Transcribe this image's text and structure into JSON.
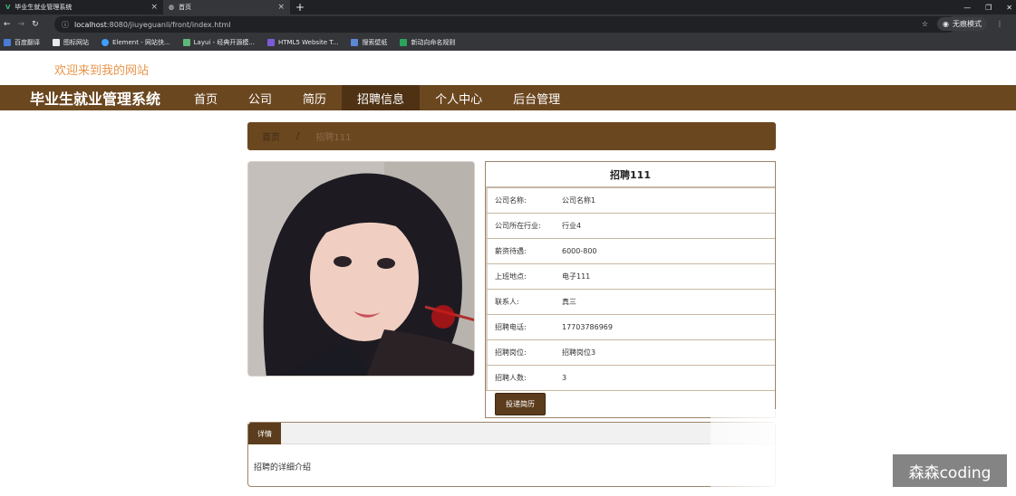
{
  "browser": {
    "tabs": [
      {
        "title": "毕业生就业管理系统",
        "active": false
      },
      {
        "title": "首页",
        "active": true
      }
    ],
    "url_host": "localhost",
    "url_rest": ":8080/jiuyeguanli/front/index.html",
    "profile_label": "无痕模式",
    "bookmarks": [
      "百度翻译",
      "图标网站",
      "Element - 网站快...",
      "Layui - 经典开源模...",
      "HTML5 Website T...",
      "搜索壁纸",
      "新动向命名规则"
    ]
  },
  "site": {
    "welcome": "欢迎来到我的网站",
    "brand": "毕业生就业管理系统",
    "nav": [
      "首页",
      "公司",
      "简历",
      "招聘信息",
      "个人中心",
      "后台管理"
    ],
    "nav_active_index": 3
  },
  "breadcrumb": {
    "home": "首页",
    "sep": "/",
    "current": "招聘111"
  },
  "job": {
    "title": "招聘111",
    "fields": [
      {
        "label": "公司名称:",
        "value": "公司名称1"
      },
      {
        "label": "公司所在行业:",
        "value": "行业4"
      },
      {
        "label": "薪资待遇:",
        "value": "6000-800"
      },
      {
        "label": "上班地点:",
        "value": "电子111"
      },
      {
        "label": "联系人:",
        "value": "真三"
      },
      {
        "label": "招聘电话:",
        "value": "17703786969"
      },
      {
        "label": "招聘岗位:",
        "value": "招聘岗位3"
      },
      {
        "label": "招聘人数:",
        "value": "3"
      }
    ],
    "apply_label": "投递简历"
  },
  "detail": {
    "tab": "详情",
    "body": "招聘的详细介绍"
  },
  "watermark": "森森coding",
  "colors": {
    "brown": "#6b4720",
    "dark_brown": "#5b3c1c",
    "welcome": "#e8954a"
  }
}
